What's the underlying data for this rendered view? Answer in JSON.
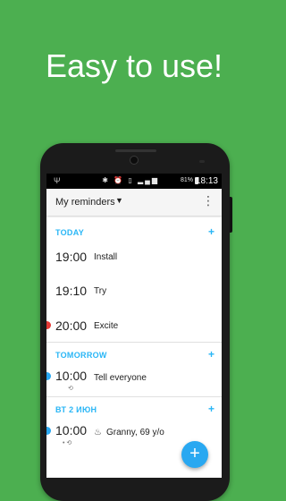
{
  "colors": {
    "background": "#4caf50",
    "accent": "#29b6f6",
    "dot_red": "#e53935",
    "dot_blue": "#29a8f1"
  },
  "headline": "Easy to use!",
  "statusbar": {
    "usb_icon": "usb-icon",
    "battery_pct": "81%",
    "time": "18:13"
  },
  "toolbar": {
    "title": "My reminders",
    "caret_icon": "dropdown-caret-icon",
    "menu_icon": "overflow-menu-icon"
  },
  "sections": {
    "today": {
      "header": "TODAY",
      "add": "+"
    },
    "tomorrow": {
      "header": "TOMORROW",
      "add": "+"
    },
    "date": {
      "header_day": "ВТ",
      "header_date": "2 ИЮН",
      "add": "+"
    }
  },
  "reminders": {
    "r1": {
      "time": "19:00",
      "label": "Install"
    },
    "r2": {
      "time": "19:10",
      "label": "Try"
    },
    "r3": {
      "time": "20:00",
      "label": "Excite"
    },
    "r4": {
      "time": "10:00",
      "label": "Tell everyone",
      "repeat_icon": "repeat-icon"
    },
    "r5": {
      "time": "10:00",
      "label": "Granny, 69 y/o",
      "icon": "birthday-cake-icon"
    }
  },
  "fab": {
    "label": "+"
  }
}
